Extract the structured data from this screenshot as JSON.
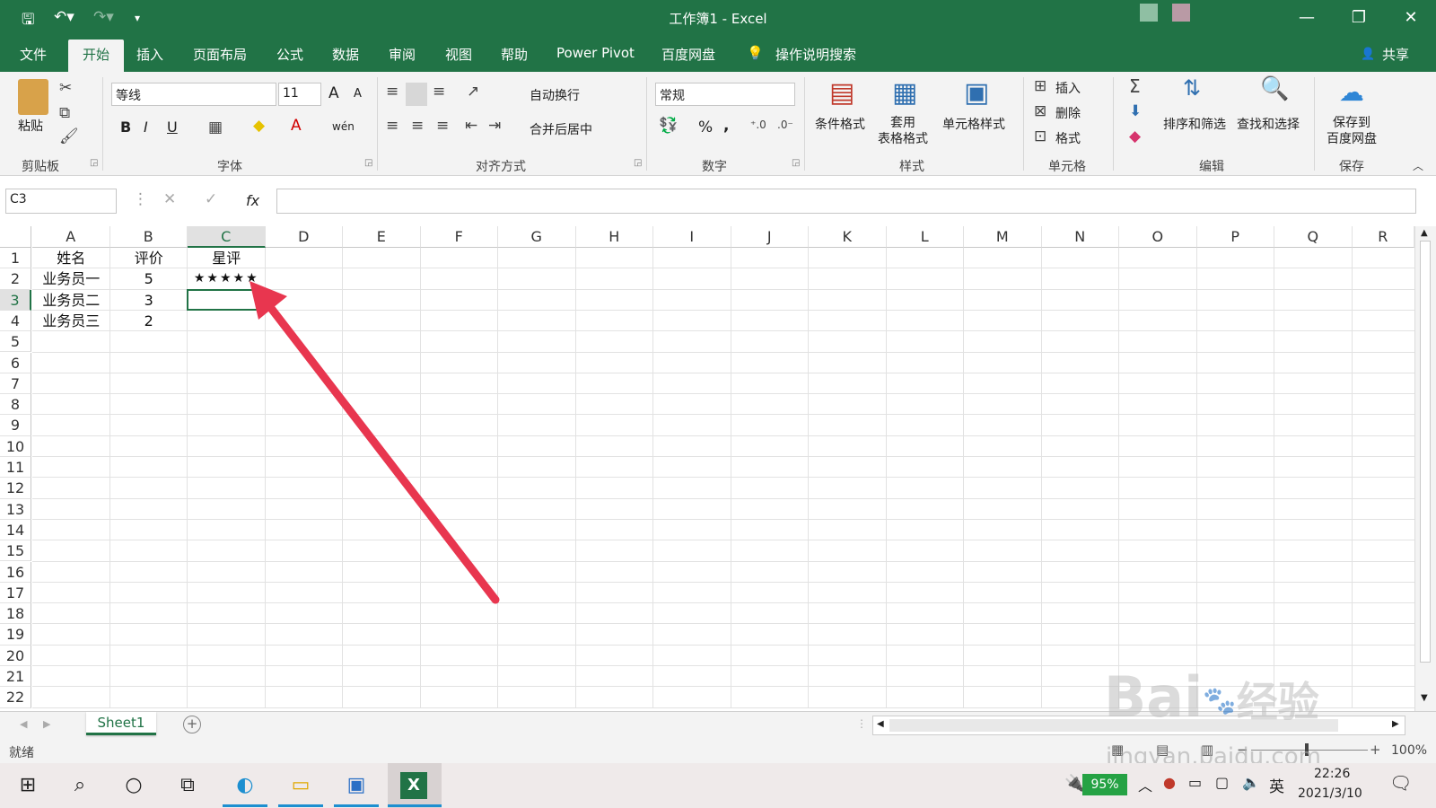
{
  "app": {
    "title": "工作簿1  -  Excel",
    "accent": "#217346"
  },
  "window": {
    "minimize": "—",
    "restore": "❐",
    "close": "✕"
  },
  "tabs": [
    "文件",
    "开始",
    "插入",
    "页面布局",
    "公式",
    "数据",
    "审阅",
    "视图",
    "帮助",
    "Power Pivot",
    "百度网盘"
  ],
  "active_tab": "开始",
  "tell_me": "操作说明搜索",
  "share": "共享",
  "ribbon": {
    "clipboard": {
      "paste": "粘贴",
      "group": "剪贴板"
    },
    "font": {
      "name": "等线",
      "size": "11",
      "bold": "B",
      "italic": "I",
      "underline": "U",
      "grow": "A",
      "shrink": "A",
      "phonetic": "wén",
      "group": "字体"
    },
    "alignment": {
      "wrap": "自动换行",
      "merge": "合并后居中",
      "group": "对齐方式"
    },
    "number": {
      "format": "常规",
      "percent": "%",
      "comma": ",",
      "group": "数字"
    },
    "styles": {
      "conditional": "条件格式",
      "table": "套用\n表格格式",
      "cell_styles": "单元格样式",
      "group": "样式"
    },
    "cells": {
      "insert": "插入",
      "delete": "删除",
      "format": "格式",
      "group": "单元格"
    },
    "editing": {
      "sort": "排序和筛选",
      "find": "查找和选择",
      "group": "编辑"
    },
    "save": {
      "label": "保存到\n百度网盘",
      "group": "保存"
    }
  },
  "formula_bar": {
    "name_box": "C3",
    "fx": "fx",
    "value": ""
  },
  "grid": {
    "columns": [
      "A",
      "B",
      "C",
      "D",
      "E",
      "F",
      "G",
      "H",
      "I",
      "J",
      "K",
      "L",
      "M",
      "N",
      "O",
      "P",
      "Q",
      "R"
    ],
    "rows": [
      "1",
      "2",
      "3",
      "4",
      "5",
      "6",
      "7",
      "8",
      "9",
      "10",
      "11",
      "12",
      "13",
      "14",
      "15",
      "16",
      "17",
      "18",
      "19",
      "20",
      "21",
      "22"
    ],
    "selected_cell": "C3",
    "cells": {
      "A1": "姓名",
      "B1": "评价",
      "C1": "星评",
      "A2": "业务员一",
      "B2": "5",
      "C2": "★★★★★",
      "A3": "业务员二",
      "B3": "3",
      "A4": "业务员三",
      "B4": "2"
    }
  },
  "sheets": {
    "tabs": [
      "Sheet1"
    ]
  },
  "status": {
    "ready": "就绪",
    "zoom": "100%"
  },
  "watermark": {
    "line1": "Bai",
    "line2": "经验",
    "url": "jingyan.baidu.com"
  },
  "taskbar": {
    "battery": "95%",
    "ime": "英",
    "time": "22:26",
    "date": "2021/3/10"
  },
  "colors": {
    "arrow": "#e8364f",
    "selection": "#217346"
  }
}
